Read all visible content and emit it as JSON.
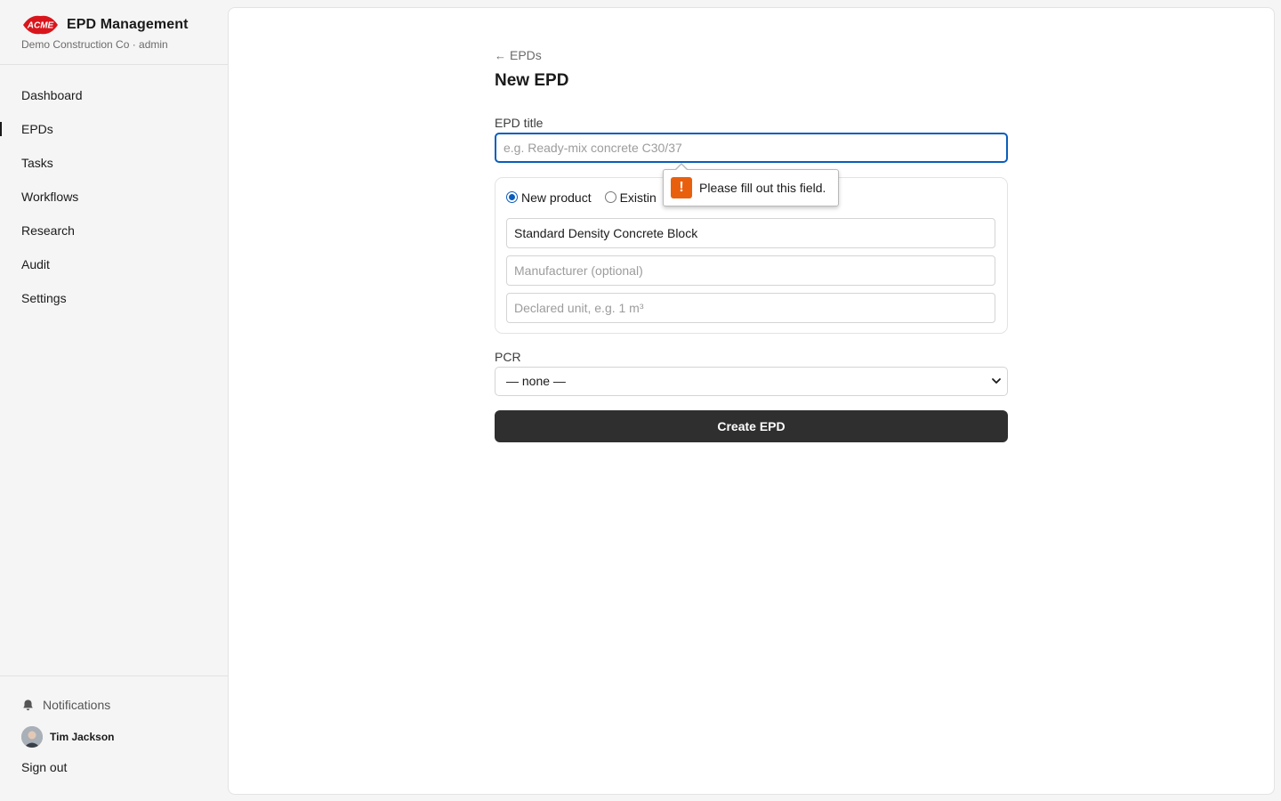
{
  "app": {
    "title": "EPD Management",
    "subtitle": "Demo Construction Co · admin",
    "logo_text": "ACME"
  },
  "sidebar": {
    "items": [
      {
        "label": "Dashboard"
      },
      {
        "label": "EPDs"
      },
      {
        "label": "Tasks"
      },
      {
        "label": "Workflows"
      },
      {
        "label": "Research"
      },
      {
        "label": "Audit"
      },
      {
        "label": "Settings"
      }
    ],
    "active_item": "EPDs",
    "notifications_label": "Notifications",
    "user_name": "Tim Jackson",
    "signout_label": "Sign out"
  },
  "page": {
    "back_label": "EPDs",
    "title": "New EPD"
  },
  "form": {
    "epd_title": {
      "label": "EPD title",
      "value": "",
      "placeholder": "e.g. Ready-mix concrete C30/37"
    },
    "product_mode": {
      "options": [
        "New product",
        "Existin"
      ],
      "selected": "New product"
    },
    "product_name": {
      "value": "Standard Density Concrete Block"
    },
    "manufacturer": {
      "value": "",
      "placeholder": "Manufacturer (optional)"
    },
    "declared_unit": {
      "value": "",
      "placeholder": "Declared unit, e.g. 1 m³"
    },
    "pcr": {
      "label": "PCR",
      "selected": "— none —"
    },
    "submit_label": "Create EPD"
  },
  "validation": {
    "message": "Please fill out this field.",
    "icon": "warning-icon",
    "icon_glyph": "!"
  },
  "colors": {
    "accent": "#0a5dbd",
    "logo_red": "#d9151c",
    "button_dark": "#2f2f2f",
    "warning_orange": "#e8600e"
  }
}
